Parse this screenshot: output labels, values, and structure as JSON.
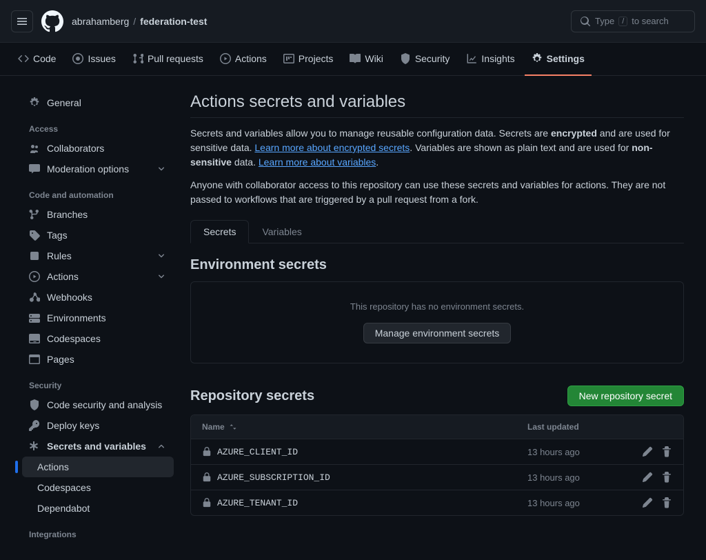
{
  "header": {
    "owner": "abrahamberg",
    "repo": "federation-test",
    "search_placeholder": "Type",
    "search_hint": "to search",
    "shortcut": "/"
  },
  "repo_nav": [
    {
      "label": "Code",
      "name": "code"
    },
    {
      "label": "Issues",
      "name": "issues"
    },
    {
      "label": "Pull requests",
      "name": "pull-requests"
    },
    {
      "label": "Actions",
      "name": "actions"
    },
    {
      "label": "Projects",
      "name": "projects"
    },
    {
      "label": "Wiki",
      "name": "wiki"
    },
    {
      "label": "Security",
      "name": "security"
    },
    {
      "label": "Insights",
      "name": "insights"
    },
    {
      "label": "Settings",
      "name": "settings"
    }
  ],
  "sidebar": {
    "general": "General",
    "groups": {
      "access": {
        "title": "Access",
        "items": [
          "Collaborators",
          "Moderation options"
        ]
      },
      "code_automation": {
        "title": "Code and automation",
        "items": [
          "Branches",
          "Tags",
          "Rules",
          "Actions",
          "Webhooks",
          "Environments",
          "Codespaces",
          "Pages"
        ]
      },
      "security": {
        "title": "Security",
        "items": [
          "Code security and analysis",
          "Deploy keys",
          "Secrets and variables"
        ],
        "subitems": [
          "Actions",
          "Codespaces",
          "Dependabot"
        ]
      },
      "integrations": {
        "title": "Integrations"
      }
    }
  },
  "page": {
    "title": "Actions secrets and variables",
    "desc1_a": "Secrets and variables allow you to manage reusable configuration data. Secrets are ",
    "desc1_b": "encrypted",
    "desc1_c": " and are used for sensitive data. ",
    "link1": "Learn more about encrypted secrets",
    "desc1_d": ". Variables are shown as plain text and are used for ",
    "desc1_e": "non-sensitive",
    "desc1_f": " data. ",
    "link2": "Learn more about variables",
    "desc2": "Anyone with collaborator access to this repository can use these secrets and variables for actions. They are not passed to workflows that are triggered by a pull request from a fork.",
    "tabs": {
      "secrets": "Secrets",
      "variables": "Variables"
    },
    "env": {
      "title": "Environment secrets",
      "empty": "This repository has no environment secrets.",
      "button": "Manage environment secrets"
    },
    "repo": {
      "title": "Repository secrets",
      "new_button": "New repository secret",
      "col_name": "Name",
      "col_updated": "Last updated",
      "rows": [
        {
          "name": "AZURE_CLIENT_ID",
          "updated": "13 hours ago"
        },
        {
          "name": "AZURE_SUBSCRIPTION_ID",
          "updated": "13 hours ago"
        },
        {
          "name": "AZURE_TENANT_ID",
          "updated": "13 hours ago"
        }
      ]
    }
  }
}
